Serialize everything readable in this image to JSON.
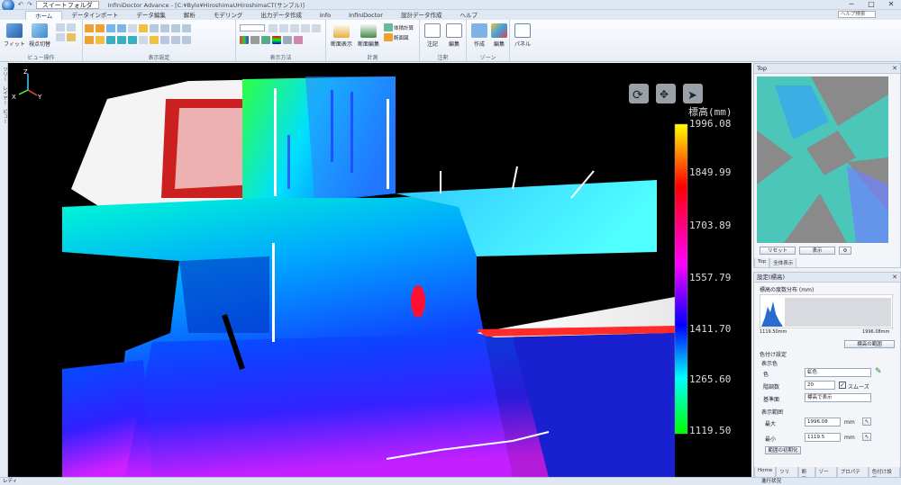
{
  "titlebar": {
    "quick_access_label": "スイートフォルダ",
    "title": "InfiniDoctor Advance - [C:¥Bylo¥HiroshimaUHiroshimaCT(サンプル)]",
    "minimize": "─",
    "restore": "□",
    "close": "✕"
  },
  "tabs": [
    {
      "label": "ホーム",
      "active": true
    },
    {
      "label": "データインポート",
      "active": false
    },
    {
      "label": "データ編集",
      "active": false
    },
    {
      "label": "解析",
      "active": false
    },
    {
      "label": "モデリング",
      "active": false
    },
    {
      "label": "出力データ作成",
      "active": false
    },
    {
      "label": "Info",
      "active": false
    },
    {
      "label": "InfiniDoctor",
      "active": false
    },
    {
      "label": "設計データ作成",
      "active": false
    },
    {
      "label": "ヘルプ",
      "active": false
    }
  ],
  "help_search": "ヘルプ検索",
  "ribbon": {
    "groups": [
      {
        "label": "ビュー操作"
      },
      {
        "label": "表示設定"
      },
      {
        "label": "表示方法"
      },
      {
        "label": "計測"
      },
      {
        "label": "注釈"
      },
      {
        "label": "ゾーン"
      }
    ],
    "buttons": {
      "fit": "フィット",
      "view_switch": "視点切替",
      "section_show": "断面表示",
      "section_edit": "断面編集",
      "volume_calc": "体積計算",
      "section_view": "断面図",
      "note": "注記",
      "edit": "編集",
      "create": "作成",
      "zone_edit": "編集",
      "panel": "パネル"
    }
  },
  "leftstrip": {
    "items": [
      "ツリー",
      "レイヤー",
      "ビュー"
    ]
  },
  "viewport": {
    "axis_labels": {
      "z": "Z",
      "y": "Y",
      "x": "X"
    },
    "legend": {
      "title": "標高(mm)",
      "ticks": [
        "1996.08",
        "1849.99",
        "1703.89",
        "1557.79",
        "1411.70",
        "1265.60",
        "1119.50"
      ],
      "colors": [
        "#ffff00",
        "#ff0000",
        "#ff00ff",
        "#0000ff",
        "#00ffff",
        "#00ff00"
      ]
    }
  },
  "top_panel": {
    "title": "Top",
    "buttons": {
      "reset": "リセット",
      "apply": "表示"
    },
    "tabs": [
      "Top",
      "全体表示"
    ]
  },
  "prop_panel": {
    "title": "設定(標高)",
    "histogram_title": "標高の度数分布 (mm)",
    "hist_min": "1119.50mm",
    "hist_max": "1996.08mm",
    "hist_button": "標高の範囲",
    "section_color": "色付け設定",
    "display_label": "表示色",
    "color_label": "色",
    "color_value": "虹色",
    "step_label": "階調数",
    "step_value": "20",
    "smooth_label": "スムーズ",
    "smooth_checked": true,
    "ref_label": "基準面",
    "ref_value": "標高で表示",
    "range_section": "表示範囲",
    "max_label": "最大",
    "max_value": "1996.08",
    "min_label": "最小",
    "min_value": "1119.5",
    "unit": "mm",
    "reset_button": "範囲の初期化",
    "bottom_tabs": [
      "Home",
      "ツリー",
      "断面",
      "ゾーン",
      "プロパティ",
      "色付け設定"
    ]
  },
  "status": {
    "left": "レディ",
    "right": "進行状況"
  }
}
